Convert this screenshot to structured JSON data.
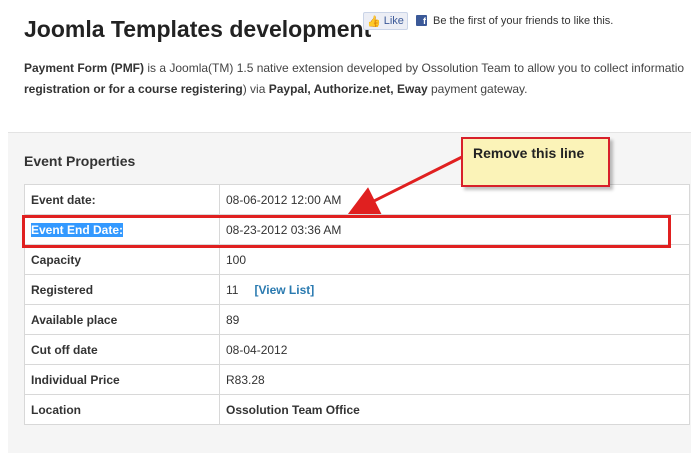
{
  "page": {
    "title": "Joomla Templates development"
  },
  "facebook": {
    "like_label": "Like",
    "fb_glyph": "f",
    "prompt": "Be the first of your friends to like this."
  },
  "intro": {
    "line1_bold": "Payment Form (PMF)",
    "line1_rest": " is a Joomla(TM) 1.5 native extension developed by Ossolution Team to allow you to collect informatio",
    "line2_bold_a": "registration or for a course registering",
    "line2_mid": ") via ",
    "line2_bold_b": "Paypal, Authorize.net, Eway",
    "line2_rest": " payment gateway."
  },
  "event_properties": {
    "heading": "Event Properties",
    "rows": [
      {
        "label": "Event date:",
        "value": "08-06-2012 12:00 AM"
      },
      {
        "label": "Event End Date:",
        "value": "08-23-2012 03:36 AM"
      },
      {
        "label": "Capacity",
        "value": "100"
      },
      {
        "label": "Registered",
        "value": "11",
        "link": "[View List]"
      },
      {
        "label": "Available place",
        "value": "89"
      },
      {
        "label": "Cut off date",
        "value": "08-04-2012"
      },
      {
        "label": "Individual Price",
        "value": "R83.28"
      },
      {
        "label": "Location",
        "value": "Ossolution Team Office"
      }
    ]
  },
  "annotation": {
    "callout_text": "Remove this line",
    "highlight_color": "#e02020",
    "callout_bg": "#fbf3b8"
  },
  "colors": {
    "price": "#c0392b",
    "location": "#3a7a1f",
    "link": "#2a7ab0",
    "selection": "#3399ff"
  }
}
